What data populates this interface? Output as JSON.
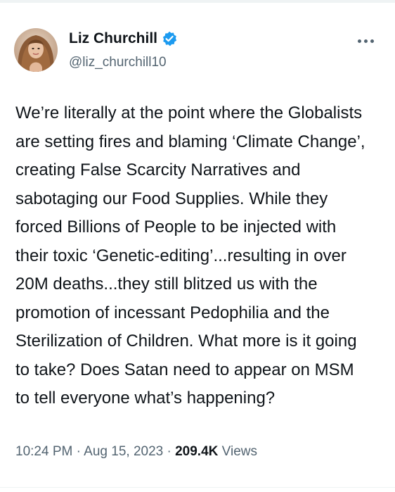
{
  "tweet": {
    "author": {
      "display_name": "Liz Churchill",
      "handle": "@liz_churchill10",
      "verified_icon": "verified-badge-icon",
      "avatar_icon": "profile-photo"
    },
    "more_icon": "more-options-icon",
    "text": "We’re literally at the point where the Globalists\nare setting fires and blaming ‘Climate Change’,\ncreating False Scarcity Narratives and\nsabotaging our Food Supplies. While they\nforced Billions of People to be injected with\ntheir toxic ‘Genetic-editing’...resulting in over\n20M deaths...they still blitzed us with the\npromotion of incessant Pedophilia and the\nSterilization of Children. What more is it going\nto take? Does Satan need to appear on MSM\nto tell everyone what’s happening?",
    "time": "10:24 PM",
    "separator": "·",
    "date": "Aug 15, 2023",
    "views_count": "209.4K",
    "views_label": "Views"
  },
  "colors": {
    "text_primary": "#0f1419",
    "text_secondary": "#536471",
    "verified_blue": "#1d9bf0",
    "divider": "#eff3f4"
  }
}
